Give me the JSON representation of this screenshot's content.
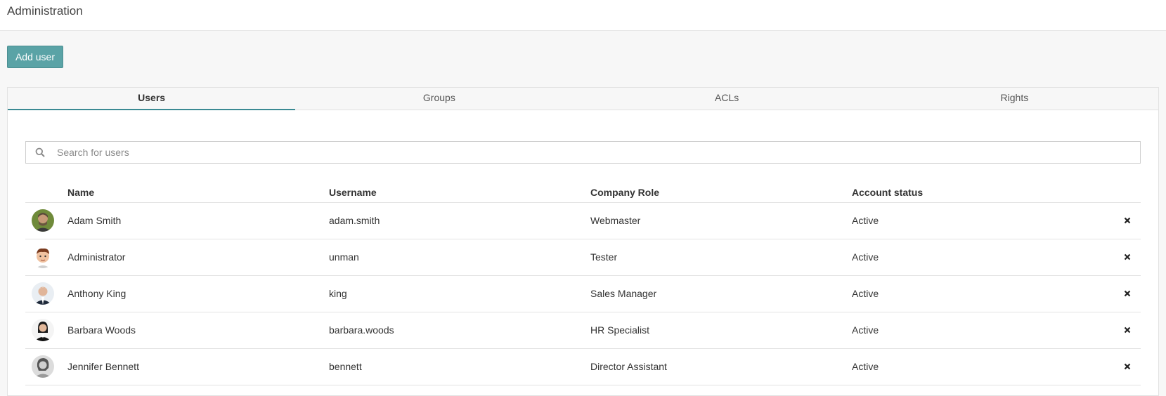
{
  "header": {
    "title": "Administration"
  },
  "actions": {
    "add_user_label": "Add user"
  },
  "tabs": [
    {
      "label": "Users",
      "active": true
    },
    {
      "label": "Groups",
      "active": false
    },
    {
      "label": "ACLs",
      "active": false
    },
    {
      "label": "Rights",
      "active": false
    }
  ],
  "search": {
    "placeholder": "Search for users",
    "value": ""
  },
  "table": {
    "columns": {
      "name": "Name",
      "username": "Username",
      "role": "Company Role",
      "status": "Account status"
    },
    "rows": [
      {
        "name": "Adam Smith",
        "username": "adam.smith",
        "role": "Webmaster",
        "status": "Active",
        "avatar": "photo-man-beard"
      },
      {
        "name": "Administrator",
        "username": "unman",
        "role": "Tester",
        "status": "Active",
        "avatar": "cartoon-man"
      },
      {
        "name": "Anthony King",
        "username": "king",
        "role": "Sales Manager",
        "status": "Active",
        "avatar": "photo-man-suit"
      },
      {
        "name": "Barbara Woods",
        "username": "barbara.woods",
        "role": "HR Specialist",
        "status": "Active",
        "avatar": "photo-woman-dark"
      },
      {
        "name": "Jennifer Bennett",
        "username": "bennett",
        "role": "Director Assistant",
        "status": "Active",
        "avatar": "photo-woman-bw"
      }
    ]
  },
  "colors": {
    "accent": "#5aa3a6",
    "tab_underline": "#3b8a93"
  },
  "icons": {
    "search": "search-icon",
    "delete": "close-icon"
  }
}
